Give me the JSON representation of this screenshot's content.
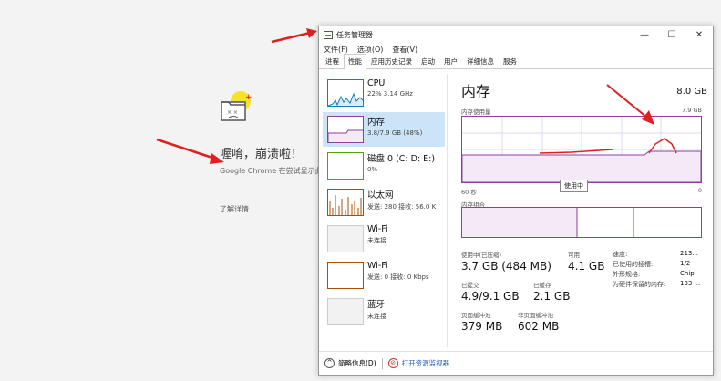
{
  "chrome": {
    "crash_title": "喔唷，崩溃啦！",
    "crash_desc": "Google Chrome 在尝试显示此",
    "learn_more": "了解详情"
  },
  "window": {
    "title": "任务管理器",
    "minimize": "—",
    "maximize": "☐",
    "close": "✕"
  },
  "menu": [
    "文件(F)",
    "选项(O)",
    "查看(V)"
  ],
  "tabs": [
    "进程",
    "性能",
    "应用历史记录",
    "启动",
    "用户",
    "详细信息",
    "服务"
  ],
  "active_tab": "性能",
  "sidebar": [
    {
      "name": "CPU",
      "sub": "22% 3.14 GHz"
    },
    {
      "name": "内存",
      "sub": "3.8/7.9 GB (48%)"
    },
    {
      "name": "磁盘 0 (C: D: E:)",
      "sub": "0%"
    },
    {
      "name": "以太网",
      "sub": "发送: 280 接收: 56.0 K"
    },
    {
      "name": "Wi-Fi",
      "sub": "未连接"
    },
    {
      "name": "Wi-Fi",
      "sub": "发送: 0 接收: 0 Kbps"
    },
    {
      "name": "蓝牙",
      "sub": "未连接"
    }
  ],
  "main": {
    "title": "内存",
    "total": "8.0 GB",
    "usage_label": "内存使用量",
    "usage_max": "7.9 GB",
    "axis_left": "60 秒",
    "axis_right": "0",
    "axis_top_right": "7.9 GB",
    "composition_label": "内存组合",
    "tooltip": "使用中"
  },
  "stats": {
    "in_use_label": "使用中(已压缩)",
    "in_use": "3.7 GB (484 MB)",
    "available_label": "可用",
    "available": "4.1 GB",
    "committed_label": "已提交",
    "committed": "4.9/9.1 GB",
    "cached_label": "已缓存",
    "cached": "2.1 GB",
    "paged_label": "页面缓冲池",
    "paged": "379 MB",
    "nonpaged_label": "非页面缓冲池",
    "nonpaged": "602 MB"
  },
  "specs": [
    {
      "label": "速度:",
      "value": "213..."
    },
    {
      "label": "已使用的插槽:",
      "value": "1/2"
    },
    {
      "label": "外形规格:",
      "value": "Chip"
    },
    {
      "label": "为硬件保留的内存:",
      "value": "133 ..."
    }
  ],
  "footer": {
    "brief": "简略信息(D)",
    "monitor": "打开资源监视器"
  },
  "colors": {
    "memory": "#8b3fa0",
    "cpu": "#117dbb",
    "disk": "#4da60c",
    "ethernet": "#a74f01",
    "annotation": "#e02020"
  }
}
